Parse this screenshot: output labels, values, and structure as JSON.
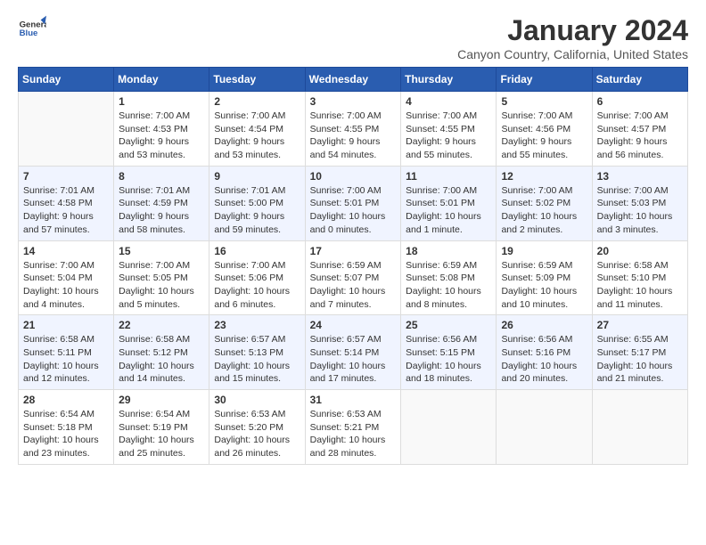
{
  "logo": {
    "general": "General",
    "blue": "Blue"
  },
  "title": "January 2024",
  "location": "Canyon Country, California, United States",
  "days_header": [
    "Sunday",
    "Monday",
    "Tuesday",
    "Wednesday",
    "Thursday",
    "Friday",
    "Saturday"
  ],
  "weeks": [
    [
      {
        "day": "",
        "detail": ""
      },
      {
        "day": "1",
        "detail": "Sunrise: 7:00 AM\nSunset: 4:53 PM\nDaylight: 9 hours\nand 53 minutes."
      },
      {
        "day": "2",
        "detail": "Sunrise: 7:00 AM\nSunset: 4:54 PM\nDaylight: 9 hours\nand 53 minutes."
      },
      {
        "day": "3",
        "detail": "Sunrise: 7:00 AM\nSunset: 4:55 PM\nDaylight: 9 hours\nand 54 minutes."
      },
      {
        "day": "4",
        "detail": "Sunrise: 7:00 AM\nSunset: 4:55 PM\nDaylight: 9 hours\nand 55 minutes."
      },
      {
        "day": "5",
        "detail": "Sunrise: 7:00 AM\nSunset: 4:56 PM\nDaylight: 9 hours\nand 55 minutes."
      },
      {
        "day": "6",
        "detail": "Sunrise: 7:00 AM\nSunset: 4:57 PM\nDaylight: 9 hours\nand 56 minutes."
      }
    ],
    [
      {
        "day": "7",
        "detail": "Sunrise: 7:01 AM\nSunset: 4:58 PM\nDaylight: 9 hours\nand 57 minutes."
      },
      {
        "day": "8",
        "detail": "Sunrise: 7:01 AM\nSunset: 4:59 PM\nDaylight: 9 hours\nand 58 minutes."
      },
      {
        "day": "9",
        "detail": "Sunrise: 7:01 AM\nSunset: 5:00 PM\nDaylight: 9 hours\nand 59 minutes."
      },
      {
        "day": "10",
        "detail": "Sunrise: 7:00 AM\nSunset: 5:01 PM\nDaylight: 10 hours\nand 0 minutes."
      },
      {
        "day": "11",
        "detail": "Sunrise: 7:00 AM\nSunset: 5:01 PM\nDaylight: 10 hours\nand 1 minute."
      },
      {
        "day": "12",
        "detail": "Sunrise: 7:00 AM\nSunset: 5:02 PM\nDaylight: 10 hours\nand 2 minutes."
      },
      {
        "day": "13",
        "detail": "Sunrise: 7:00 AM\nSunset: 5:03 PM\nDaylight: 10 hours\nand 3 minutes."
      }
    ],
    [
      {
        "day": "14",
        "detail": "Sunrise: 7:00 AM\nSunset: 5:04 PM\nDaylight: 10 hours\nand 4 minutes."
      },
      {
        "day": "15",
        "detail": "Sunrise: 7:00 AM\nSunset: 5:05 PM\nDaylight: 10 hours\nand 5 minutes."
      },
      {
        "day": "16",
        "detail": "Sunrise: 7:00 AM\nSunset: 5:06 PM\nDaylight: 10 hours\nand 6 minutes."
      },
      {
        "day": "17",
        "detail": "Sunrise: 6:59 AM\nSunset: 5:07 PM\nDaylight: 10 hours\nand 7 minutes."
      },
      {
        "day": "18",
        "detail": "Sunrise: 6:59 AM\nSunset: 5:08 PM\nDaylight: 10 hours\nand 8 minutes."
      },
      {
        "day": "19",
        "detail": "Sunrise: 6:59 AM\nSunset: 5:09 PM\nDaylight: 10 hours\nand 10 minutes."
      },
      {
        "day": "20",
        "detail": "Sunrise: 6:58 AM\nSunset: 5:10 PM\nDaylight: 10 hours\nand 11 minutes."
      }
    ],
    [
      {
        "day": "21",
        "detail": "Sunrise: 6:58 AM\nSunset: 5:11 PM\nDaylight: 10 hours\nand 12 minutes."
      },
      {
        "day": "22",
        "detail": "Sunrise: 6:58 AM\nSunset: 5:12 PM\nDaylight: 10 hours\nand 14 minutes."
      },
      {
        "day": "23",
        "detail": "Sunrise: 6:57 AM\nSunset: 5:13 PM\nDaylight: 10 hours\nand 15 minutes."
      },
      {
        "day": "24",
        "detail": "Sunrise: 6:57 AM\nSunset: 5:14 PM\nDaylight: 10 hours\nand 17 minutes."
      },
      {
        "day": "25",
        "detail": "Sunrise: 6:56 AM\nSunset: 5:15 PM\nDaylight: 10 hours\nand 18 minutes."
      },
      {
        "day": "26",
        "detail": "Sunrise: 6:56 AM\nSunset: 5:16 PM\nDaylight: 10 hours\nand 20 minutes."
      },
      {
        "day": "27",
        "detail": "Sunrise: 6:55 AM\nSunset: 5:17 PM\nDaylight: 10 hours\nand 21 minutes."
      }
    ],
    [
      {
        "day": "28",
        "detail": "Sunrise: 6:54 AM\nSunset: 5:18 PM\nDaylight: 10 hours\nand 23 minutes."
      },
      {
        "day": "29",
        "detail": "Sunrise: 6:54 AM\nSunset: 5:19 PM\nDaylight: 10 hours\nand 25 minutes."
      },
      {
        "day": "30",
        "detail": "Sunrise: 6:53 AM\nSunset: 5:20 PM\nDaylight: 10 hours\nand 26 minutes."
      },
      {
        "day": "31",
        "detail": "Sunrise: 6:53 AM\nSunset: 5:21 PM\nDaylight: 10 hours\nand 28 minutes."
      },
      {
        "day": "",
        "detail": ""
      },
      {
        "day": "",
        "detail": ""
      },
      {
        "day": "",
        "detail": ""
      }
    ]
  ]
}
